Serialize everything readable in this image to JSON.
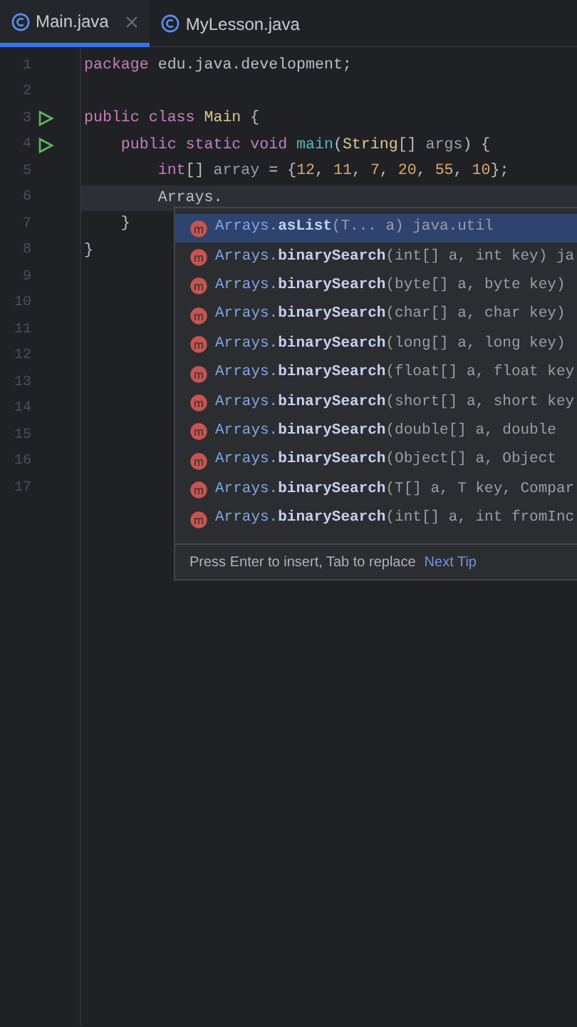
{
  "tabs": [
    {
      "label": "Main.java",
      "selected": true,
      "closable": true
    },
    {
      "label": "MyLesson.java",
      "selected": false,
      "closable": false
    }
  ],
  "editor": {
    "lines": [
      {
        "number": "1",
        "run": false,
        "tokens": [
          {
            "text": "package",
            "kind": "keyword"
          },
          {
            "text": " edu.java.development;",
            "kind": "plain"
          }
        ]
      },
      {
        "number": "2",
        "run": false
      },
      {
        "number": "3",
        "run": true,
        "tokens": [
          {
            "text": "public class",
            "kind": "keyword"
          },
          {
            "text": " Main ",
            "kind": "type"
          },
          {
            "text": "{",
            "kind": "plain"
          }
        ]
      },
      {
        "number": "4",
        "run": true,
        "tokens": [
          {
            "text": "    public static void",
            "kind": "keyword"
          },
          {
            "text": " main",
            "kind": "method"
          },
          {
            "text": "(",
            "kind": "plain"
          },
          {
            "text": "String",
            "kind": "type"
          },
          {
            "text": "[] ",
            "kind": "plain"
          },
          {
            "text": "args",
            "kind": "param"
          },
          {
            "text": ") {",
            "kind": "plain"
          }
        ]
      },
      {
        "number": "5",
        "run": false,
        "tokens": [
          {
            "text": "        int",
            "kind": "keyword"
          },
          {
            "text": "[] ",
            "kind": "plain"
          },
          {
            "text": "array",
            "kind": "param"
          },
          {
            "text": " = {",
            "kind": "plain"
          },
          {
            "text": "12",
            "kind": "number"
          },
          {
            "text": ", ",
            "kind": "plain"
          },
          {
            "text": "11",
            "kind": "number"
          },
          {
            "text": ", ",
            "kind": "plain"
          },
          {
            "text": "7",
            "kind": "number"
          },
          {
            "text": ", ",
            "kind": "plain"
          },
          {
            "text": "20",
            "kind": "number"
          },
          {
            "text": ", ",
            "kind": "plain"
          },
          {
            "text": "55",
            "kind": "number"
          },
          {
            "text": ", ",
            "kind": "plain"
          },
          {
            "text": "10",
            "kind": "number"
          },
          {
            "text": "};",
            "kind": "plain"
          }
        ]
      },
      {
        "number": "6",
        "run": false,
        "current": true,
        "tokens": [
          {
            "text": "        Arrays.",
            "kind": "plain"
          }
        ]
      },
      {
        "number": "7",
        "run": false,
        "tokens": [
          {
            "text": "    }",
            "kind": "plain"
          }
        ]
      },
      {
        "number": "8",
        "run": false,
        "tokens": [
          {
            "text": "}",
            "kind": "plain"
          }
        ]
      },
      {
        "number": "9",
        "run": false
      },
      {
        "number": "10",
        "run": false
      },
      {
        "number": "11",
        "run": false
      },
      {
        "number": "12",
        "run": false
      },
      {
        "number": "13",
        "run": false
      },
      {
        "number": "14",
        "run": false
      },
      {
        "number": "15",
        "run": false
      },
      {
        "number": "16",
        "run": false
      },
      {
        "number": "17",
        "run": false
      }
    ]
  },
  "completion": {
    "items": [
      {
        "icon": "m",
        "owner": "Arrays.",
        "name": "asList",
        "signature": "(T... a) java.util",
        "selected": true
      },
      {
        "icon": "m",
        "owner": "Arrays.",
        "name": "binarySearch",
        "signature": "(int[] a, int key) ja",
        "selected": false
      },
      {
        "icon": "m",
        "owner": "Arrays.",
        "name": "binarySearch",
        "signature": "(byte[] a, byte key)",
        "selected": false
      },
      {
        "icon": "m",
        "owner": "Arrays.",
        "name": "binarySearch",
        "signature": "(char[] a, char key)",
        "selected": false
      },
      {
        "icon": "m",
        "owner": "Arrays.",
        "name": "binarySearch",
        "signature": "(long[] a, long key)",
        "selected": false
      },
      {
        "icon": "m",
        "owner": "Arrays.",
        "name": "binarySearch",
        "signature": "(float[] a, float key",
        "selected": false
      },
      {
        "icon": "m",
        "owner": "Arrays.",
        "name": "binarySearch",
        "signature": "(short[] a, short key",
        "selected": false
      },
      {
        "icon": "m",
        "owner": "Arrays.",
        "name": "binarySearch",
        "signature": "(double[] a, double",
        "selected": false
      },
      {
        "icon": "m",
        "owner": "Arrays.",
        "name": "binarySearch",
        "signature": "(Object[] a, Object",
        "selected": false
      },
      {
        "icon": "m",
        "owner": "Arrays.",
        "name": "binarySearch",
        "signature": "(T[] a, T key, Compar",
        "selected": false
      },
      {
        "icon": "m",
        "owner": "Arrays.",
        "name": "binarySearch",
        "signature": "(int[] a, int fromInc",
        "selected": false
      }
    ],
    "hint": "Press Enter to insert, Tab to replace",
    "hint_link": "Next Tip"
  }
}
